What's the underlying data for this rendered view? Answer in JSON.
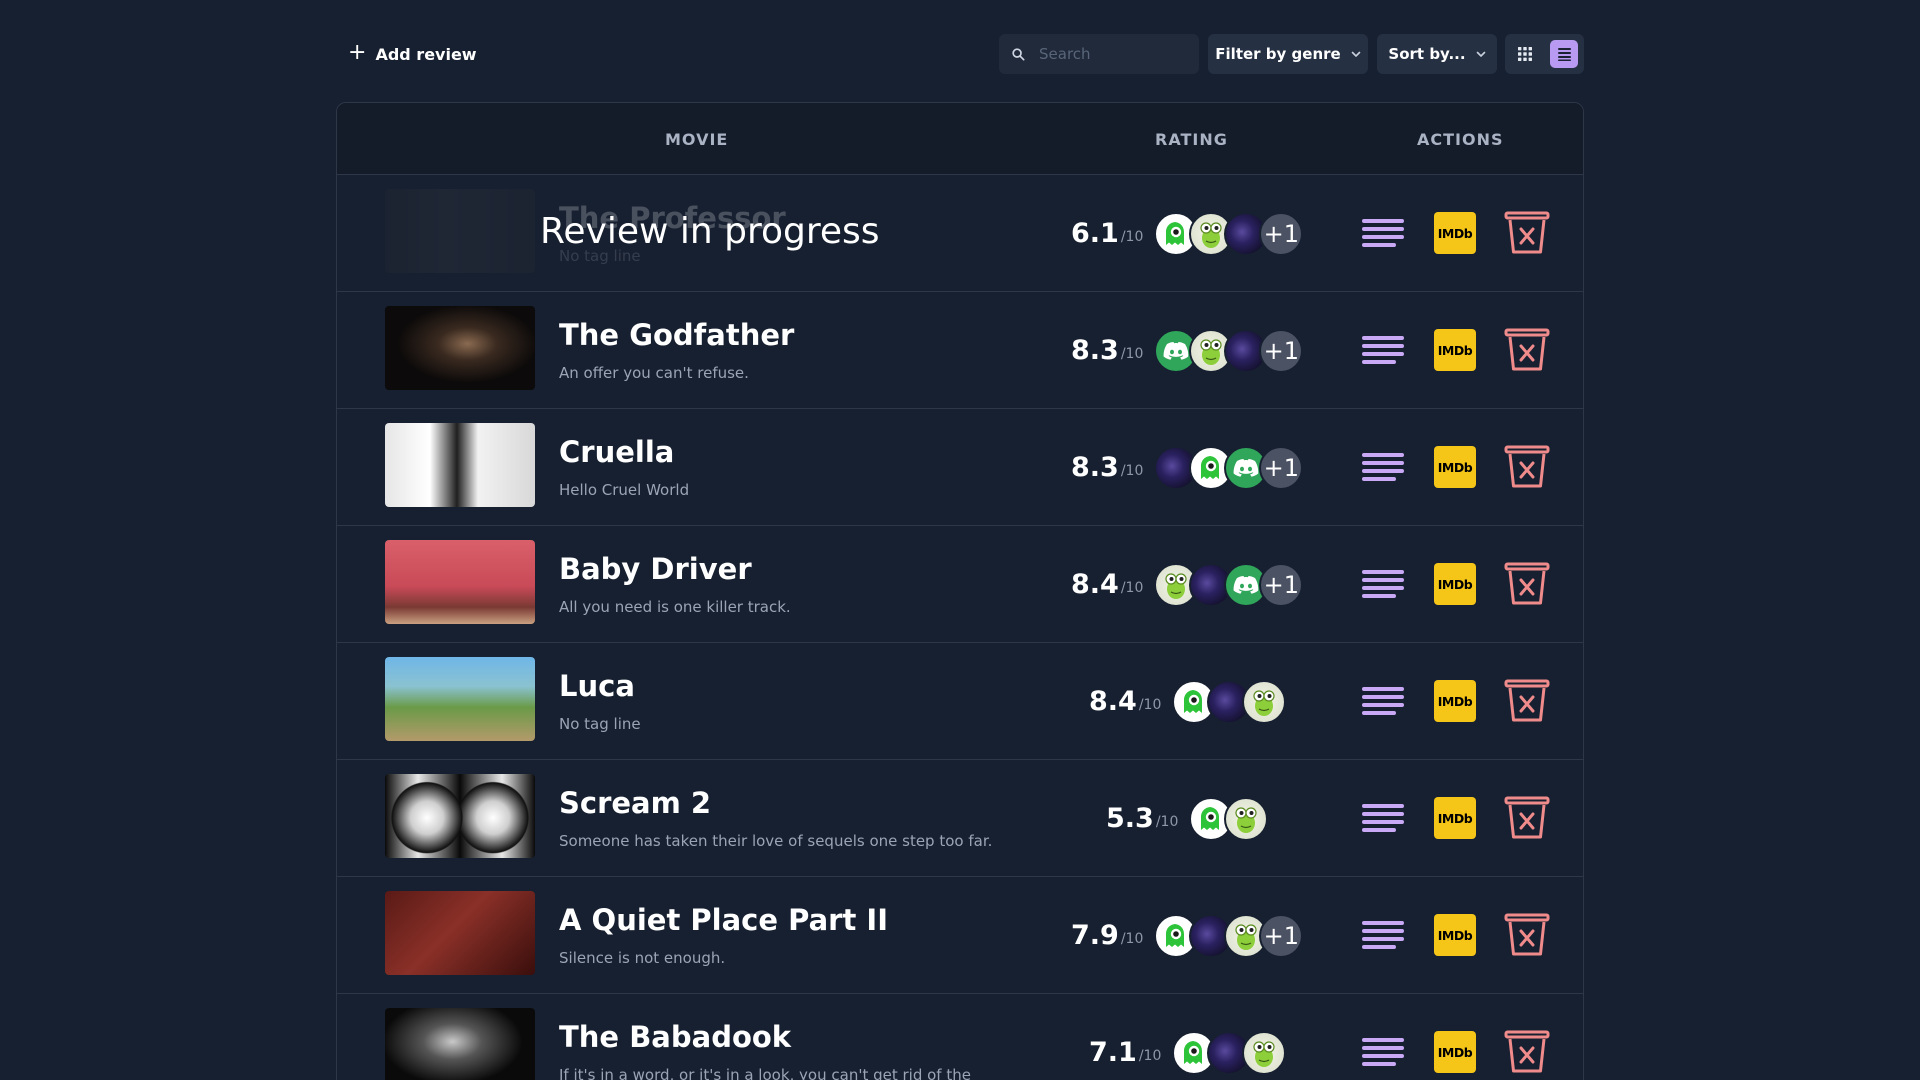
{
  "toolbar": {
    "add_review_label": "Add review",
    "search_placeholder": "Search",
    "genre_filter_label": "Filter by genre",
    "sort_label": "Sort by...",
    "view_mode": "list"
  },
  "table": {
    "headers": {
      "movie": "MOVIE",
      "rating": "RATING",
      "actions": "ACTIONS"
    },
    "rows": [
      {
        "title": "The Professor",
        "tagline": "No tag line",
        "score": "6.1",
        "out_of": "/10",
        "avatars": [
          "green-ghost",
          "croc",
          "space",
          "more"
        ],
        "more_count": "+1",
        "status": "Review in progress"
      },
      {
        "title": "The Godfather",
        "tagline": "An offer you can't refuse.",
        "score": "8.3",
        "out_of": "/10",
        "avatars": [
          "discord",
          "croc",
          "space",
          "more"
        ],
        "more_count": "+1"
      },
      {
        "title": "Cruella",
        "tagline": "Hello Cruel World",
        "score": "8.3",
        "out_of": "/10",
        "avatars": [
          "space",
          "green-ghost",
          "discord",
          "more"
        ],
        "more_count": "+1"
      },
      {
        "title": "Baby Driver",
        "tagline": "All you need is one killer track.",
        "score": "8.4",
        "out_of": "/10",
        "avatars": [
          "croc",
          "space",
          "discord",
          "more"
        ],
        "more_count": "+1"
      },
      {
        "title": "Luca",
        "tagline": "No tag line",
        "score": "8.4",
        "out_of": "/10",
        "avatars": [
          "green-ghost",
          "space",
          "croc"
        ]
      },
      {
        "title": "Scream 2",
        "tagline": "Someone has taken their love of sequels one step too far.",
        "score": "5.3",
        "out_of": "/10",
        "avatars": [
          "green-ghost",
          "croc"
        ]
      },
      {
        "title": "A Quiet Place Part II",
        "tagline": "Silence is not enough.",
        "score": "7.9",
        "out_of": "/10",
        "avatars": [
          "green-ghost",
          "space",
          "croc",
          "more"
        ],
        "more_count": "+1"
      },
      {
        "title": "The Babadook",
        "tagline": "If it's in a word, or it's in a look, you can't get rid of the",
        "score": "7.1",
        "out_of": "/10",
        "avatars": [
          "green-ghost",
          "space",
          "croc"
        ]
      }
    ],
    "imdb_label": "IMDb"
  },
  "colors": {
    "background": "#172030",
    "accent": "#b99af2",
    "imdb_yellow": "#f5c518",
    "delete_red": "#f08b8b"
  }
}
